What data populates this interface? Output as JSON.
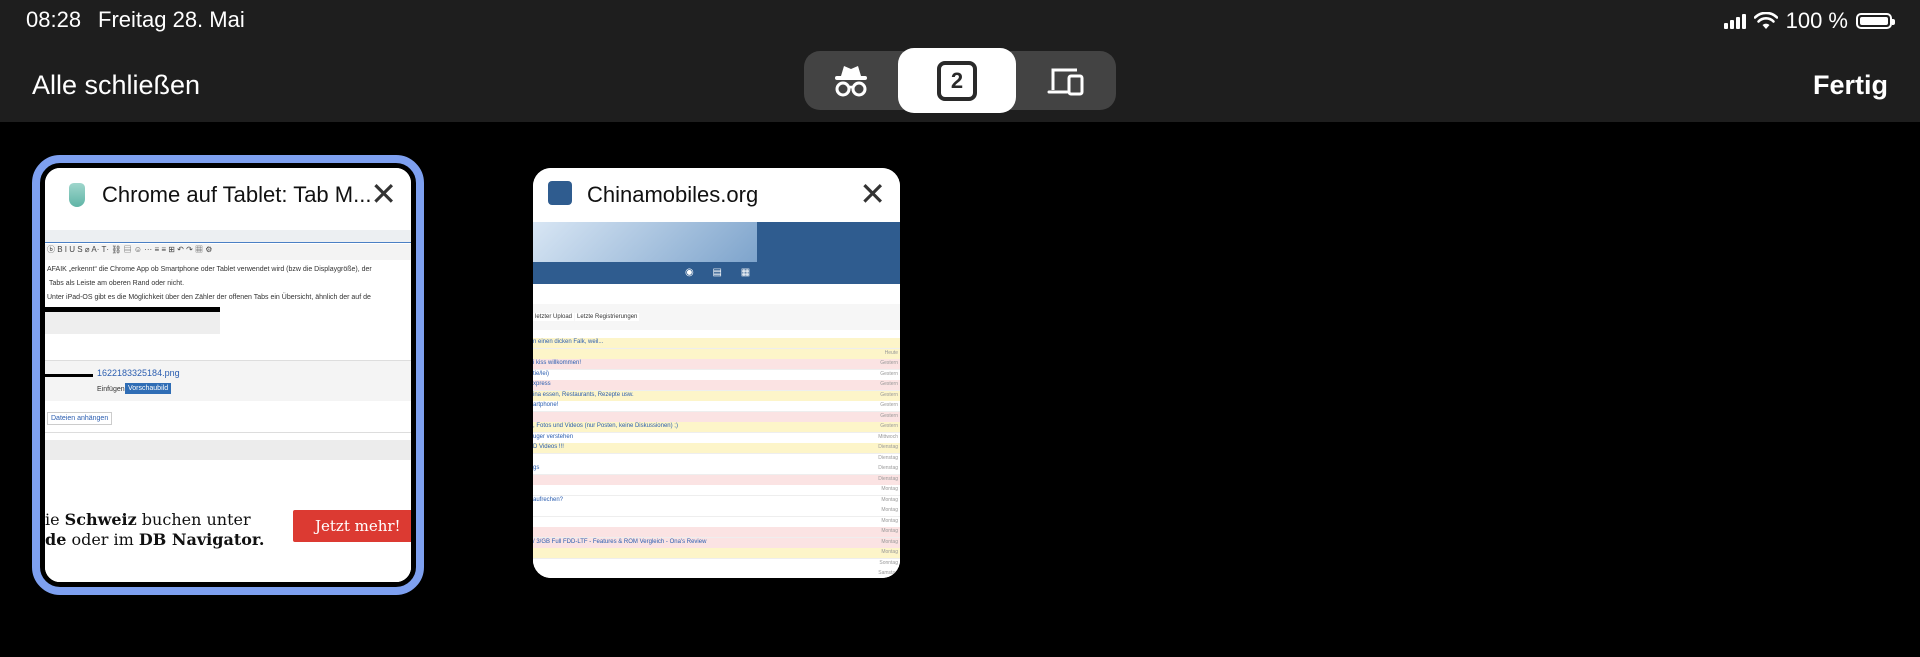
{
  "status": {
    "time": "08:28",
    "date": "Freitag 28. Mai",
    "battery": "100 %"
  },
  "toolbar": {
    "close_all": "Alle schließen",
    "done": "Fertig",
    "tab_count": "2"
  },
  "tabs": [
    {
      "title": "Chrome auf Tablet: Tab M...",
      "selected": true,
      "preview": {
        "line1": "AFAIK „erkennt“ die Chrome App ob Smartphone oder Tablet verwendet wird (bzw die Displaygröße), der",
        "line2": "Tabs als Leiste am oberen Rand oder nicht.",
        "line3": "Unter iPad-OS gibt es die Möglichkeit über den Zähler der offenen Tabs ein Übersicht, ähnlich der auf de",
        "filename": "1622183325184.png",
        "insert": "Einfügen",
        "preview_btn": "Vorschaubild",
        "attach": "Dateien anhängen",
        "ad_line1a": "ie ",
        "ad_line1b": "Schweiz",
        "ad_line1c": " buchen unter",
        "ad_line2a": "de",
        "ad_line2b": " oder im ",
        "ad_line2c": "DB Navigator.",
        "ad_button": "Jetzt mehr!"
      }
    },
    {
      "title": "Chinamobiles.org",
      "selected": false,
      "preview": {
        "tab1": "letzter Upload",
        "tab2": "Letzte Registrierungen",
        "rows": [
          {
            "text": "n einen dicken Falk, weil...",
            "date": "",
            "bg": "#fdf5c9"
          },
          {
            "text": "",
            "date": "Heute",
            "bg": "#fdf5c9"
          },
          {
            "text": "i kiss willkommen!",
            "date": "Gestern",
            "bg": "#fbe3e3"
          },
          {
            "text": "tie/lei)",
            "date": "Gestern",
            "bg": "#ffffff"
          },
          {
            "text": "xpress",
            "date": "Gestern",
            "bg": "#fbe3e3"
          },
          {
            "text": "ina essen, Restaurants, Rezepte usw.",
            "date": "Gestern",
            "bg": "#fdf5c9"
          },
          {
            "text": "artphone!",
            "date": "Gestern",
            "bg": "#ffffff"
          },
          {
            "text": "",
            "date": "Gestern",
            "bg": "#fbe3e3"
          },
          {
            "text": ", Fotos und Videos (nur Posten, keine Diskussionen) ;)",
            "date": "Gestern",
            "bg": "#fdf5c9"
          },
          {
            "text": "uger verstehen",
            "date": "Mittwoch",
            "bg": "#ffffff"
          },
          {
            "text": "D Videos !!!",
            "date": "Dienstag",
            "bg": "#fdf5c9"
          },
          {
            "text": "",
            "date": "Dienstag",
            "bg": "#ffffff"
          },
          {
            "text": "gs",
            "date": "Dienstag",
            "bg": "#ffffff"
          },
          {
            "text": "",
            "date": "Dienstag",
            "bg": "#fbe3e3"
          },
          {
            "text": "",
            "date": "Montag",
            "bg": "#ffffff"
          },
          {
            "text": "aufrechen?",
            "date": "Montag",
            "bg": "#ffffff"
          },
          {
            "text": "",
            "date": "Montag",
            "bg": "#ffffff"
          },
          {
            "text": "",
            "date": "Montag",
            "bg": "#ffffff"
          },
          {
            "text": "",
            "date": "Montag",
            "bg": "#fbe3e3"
          },
          {
            "text": "/ 3/GB Full FDD-LTF - Features & ROM Vergleich - Ona's Review",
            "date": "Montag",
            "bg": "#fbe3e3"
          },
          {
            "text": "",
            "date": "Montag",
            "bg": "#fdf5c9"
          },
          {
            "text": "",
            "date": "Sonntag",
            "bg": "#ffffff"
          },
          {
            "text": "",
            "date": "Samstag",
            "bg": "#ffffff"
          }
        ]
      }
    }
  ],
  "colors": {
    "selected_outline": "#7ea0f0",
    "topbar": "#1e1e1e",
    "ad_red": "#dc3a32",
    "site_blue": "#2f5c8f"
  },
  "icons": {
    "incognito": "incognito-icon",
    "devices": "devices-icon",
    "close": "close-icon",
    "wifi": "wifi-icon",
    "signal": "signal-icon",
    "battery": "battery-icon"
  }
}
